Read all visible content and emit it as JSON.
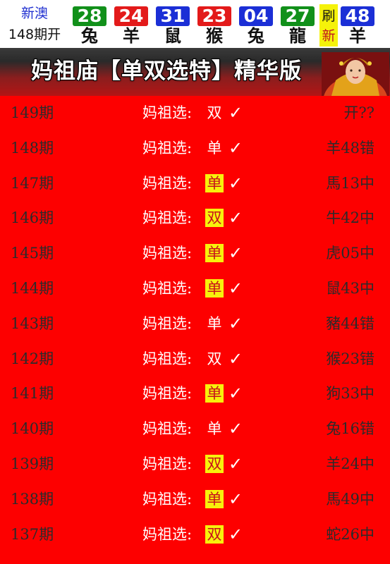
{
  "header": {
    "region": "新澳",
    "issue": "148期开",
    "balls": [
      {
        "number": "28",
        "zodiac": "兔",
        "color": "#11901a"
      },
      {
        "number": "24",
        "zodiac": "羊",
        "color": "#e31a1a"
      },
      {
        "number": "31",
        "zodiac": "鼠",
        "color": "#1b2fd6"
      },
      {
        "number": "23",
        "zodiac": "猴",
        "color": "#e31a1a"
      },
      {
        "number": "04",
        "zodiac": "兔",
        "color": "#1b2fd6"
      },
      {
        "number": "27",
        "zodiac": "龍",
        "color": "#11901a"
      }
    ],
    "refresh": {
      "line1": "刷",
      "line2": "新"
    },
    "special": {
      "number": "48",
      "zodiac": "羊",
      "color": "#1b2fd6"
    }
  },
  "banner": {
    "title": "妈祖庙【单双选特】精华版"
  },
  "pick_label": "妈祖选:",
  "check_mark": "✓",
  "rows": [
    {
      "period": "149期",
      "pick": "双",
      "highlight": false,
      "result": "开??"
    },
    {
      "period": "148期",
      "pick": "单",
      "highlight": false,
      "result": "羊48错"
    },
    {
      "period": "147期",
      "pick": "单",
      "highlight": true,
      "result": "馬13中"
    },
    {
      "period": "146期",
      "pick": "双",
      "highlight": true,
      "result": "牛42中"
    },
    {
      "period": "145期",
      "pick": "单",
      "highlight": true,
      "result": "虎05中"
    },
    {
      "period": "144期",
      "pick": "单",
      "highlight": true,
      "result": "鼠43中"
    },
    {
      "period": "143期",
      "pick": "单",
      "highlight": false,
      "result": "豬44错"
    },
    {
      "period": "142期",
      "pick": "双",
      "highlight": false,
      "result": "猴23错"
    },
    {
      "period": "141期",
      "pick": "单",
      "highlight": true,
      "result": "狗33中"
    },
    {
      "period": "140期",
      "pick": "单",
      "highlight": false,
      "result": "兔16错"
    },
    {
      "period": "139期",
      "pick": "双",
      "highlight": true,
      "result": "羊24中"
    },
    {
      "period": "138期",
      "pick": "单",
      "highlight": true,
      "result": "馬49中"
    },
    {
      "period": "137期",
      "pick": "双",
      "highlight": true,
      "result": "蛇26中"
    }
  ],
  "colors": {
    "list_background": "#fd0000",
    "highlight_background": "#f7f10c",
    "highlight_text": "#c8101c",
    "refresh_background": "#f5f20a"
  }
}
